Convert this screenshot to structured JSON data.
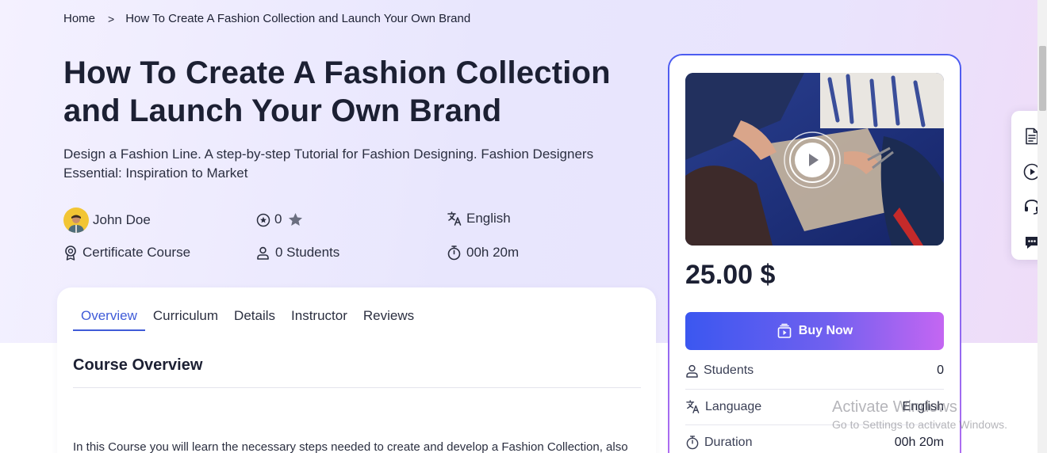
{
  "breadcrumb": {
    "home": "Home",
    "separator": ">",
    "current": "How To Create A Fashion Collection and Launch Your Own Brand"
  },
  "course": {
    "title_line1": "How To Create A Fashion Collection",
    "title_line2": "and Launch Your Own Brand",
    "subtitle_line1": "Design a Fashion Line. A step-by-step Tutorial for Fashion Designing. Fashion Designers",
    "subtitle_line2": "Essential: Inspiration to Market",
    "instructor": "John Doe",
    "rating": "0",
    "language": "English",
    "certificate": "Certificate Course",
    "students": "0 Students",
    "duration": "00h 20m"
  },
  "tabs": [
    {
      "label": "Overview",
      "active": true
    },
    {
      "label": "Curriculum"
    },
    {
      "label": "Details"
    },
    {
      "label": "Instructor"
    },
    {
      "label": "Reviews"
    }
  ],
  "overview": {
    "heading": "Course Overview",
    "text": "In this Course you will learn the necessary steps needed to create and develop a Fashion Collection, also"
  },
  "sidebar": {
    "price": "25.00 $",
    "buy_label": "Buy Now",
    "rows": [
      {
        "label": "Students",
        "value": "0",
        "icon": "user-icon"
      },
      {
        "label": "Language",
        "value": "English",
        "icon": "translate-icon"
      },
      {
        "label": "Duration",
        "value": "00h 20m",
        "icon": "stopwatch-icon"
      }
    ]
  },
  "float_actions": [
    "document-icon",
    "play-circle-icon",
    "headset-icon",
    "chat-icon"
  ],
  "watermark": {
    "line1": "Activate Windows",
    "line2": "Go to Settings to activate Windows."
  },
  "colors": {
    "accent": "#3f5bd8",
    "heading": "#1c2033",
    "button_start": "#3b57f0",
    "button_end": "#c466f2"
  }
}
